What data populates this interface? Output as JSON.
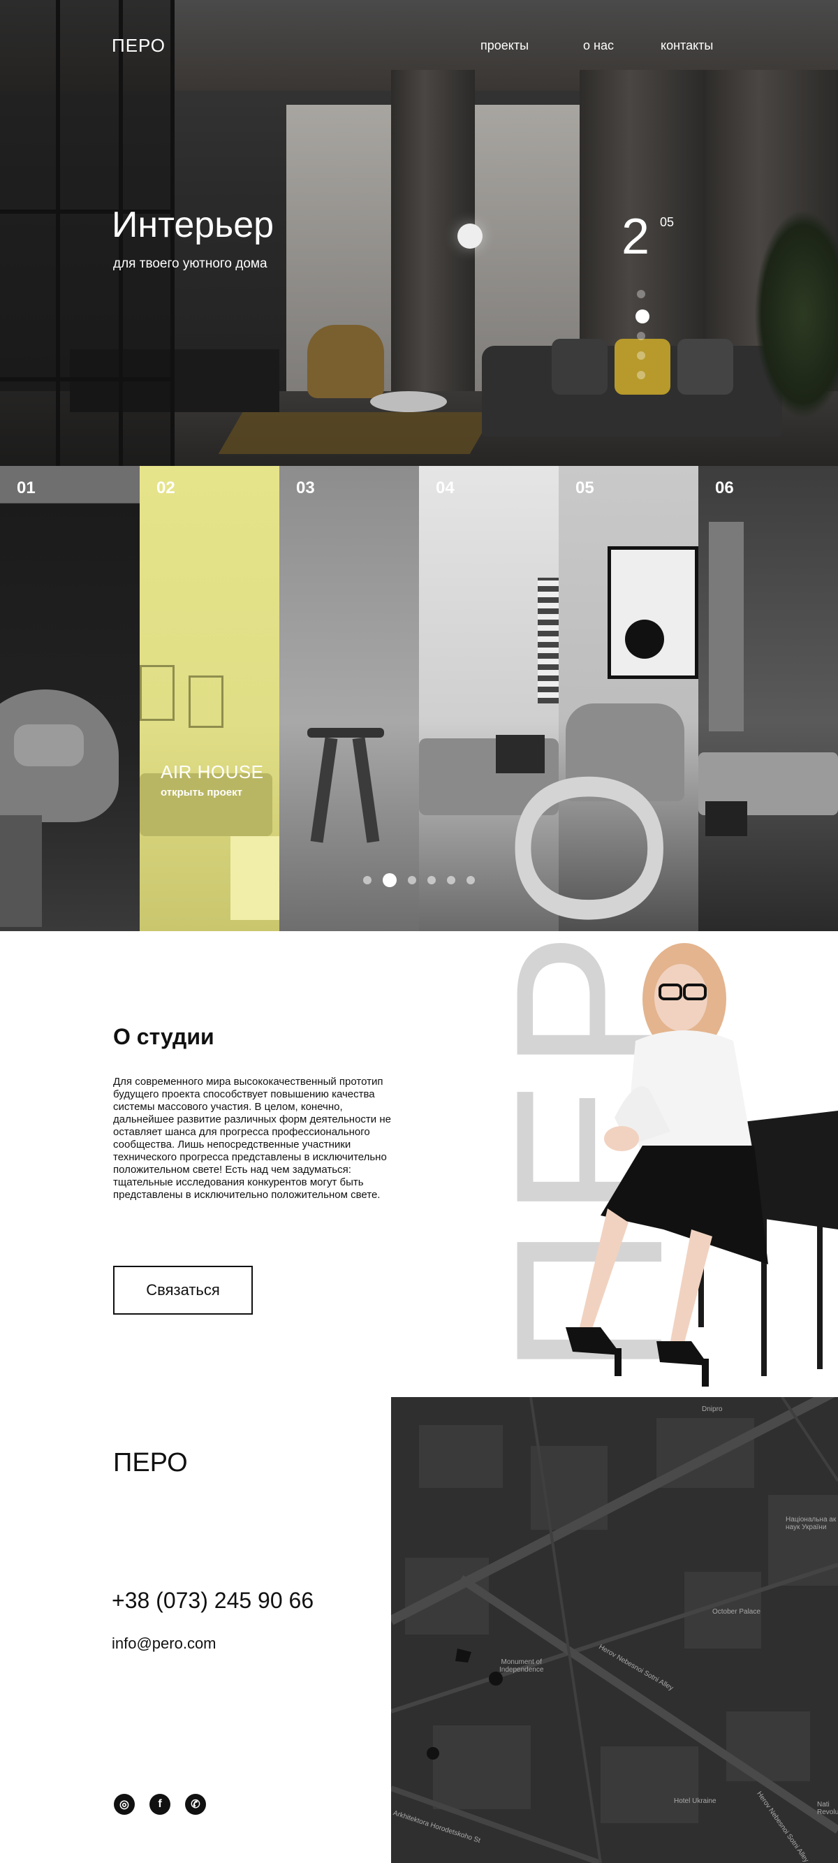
{
  "header": {
    "logo": "ПЕРО",
    "nav": [
      {
        "label": "проекты"
      },
      {
        "label": "о нас"
      },
      {
        "label": "контакты"
      }
    ]
  },
  "hero": {
    "title": "Интерьер",
    "subtitle": "для твоего уютного дома",
    "current_slide": "2",
    "total_slides": "05",
    "slide_dots_count": 5,
    "active_dot_index": 1
  },
  "projects": {
    "panels": [
      {
        "number": "01"
      },
      {
        "number": "02"
      },
      {
        "number": "03"
      },
      {
        "number": "04"
      },
      {
        "number": "05"
      },
      {
        "number": "06"
      }
    ],
    "featured_title": "AIR HOUSE",
    "featured_link": "открыть проект",
    "highlight_color": "#e6e48a",
    "dots_count": 6,
    "active_dot_index": 1
  },
  "about": {
    "title": "О студии",
    "text": "Для современного мира высококачественный прототип будущего проекта способствует повышению качества системы массового участия. В целом, конечно, дальнейшее развитие различных форм деятельности не оставляет шанса для прогресса профессионального сообщества. Лишь непосредственные участники технического прогресса представлены в исключительно положительном свете! Есть над чем задуматься: тщательные исследования конкурентов могут быть представлены в исключительно положительном свете.",
    "button_label": "Связаться",
    "watermark": "ПЕРО"
  },
  "contacts": {
    "logo": "ПЕРО",
    "phone": "+38 (073) 245 90 66",
    "email": "info@pero.com",
    "social": [
      {
        "icon": "instagram-icon",
        "glyph": "◎"
      },
      {
        "icon": "facebook-icon",
        "glyph": "f"
      },
      {
        "icon": "viber-icon",
        "glyph": "✆"
      }
    ]
  },
  "map": {
    "labels": [
      {
        "text": "Dnipro"
      },
      {
        "text": "Національна ак\nнаук України"
      },
      {
        "text": "October Palace"
      },
      {
        "text": "Monument of\nIndependence"
      },
      {
        "text": "Herov Nebesnoi Sotni Alley"
      },
      {
        "text": "Hotel Ukraine"
      },
      {
        "text": "Arkhitektora Horodetskoho St"
      },
      {
        "text": "Herov Nebesnoi Sotni Alley"
      },
      {
        "text": "Nati\nRevolu"
      }
    ]
  }
}
